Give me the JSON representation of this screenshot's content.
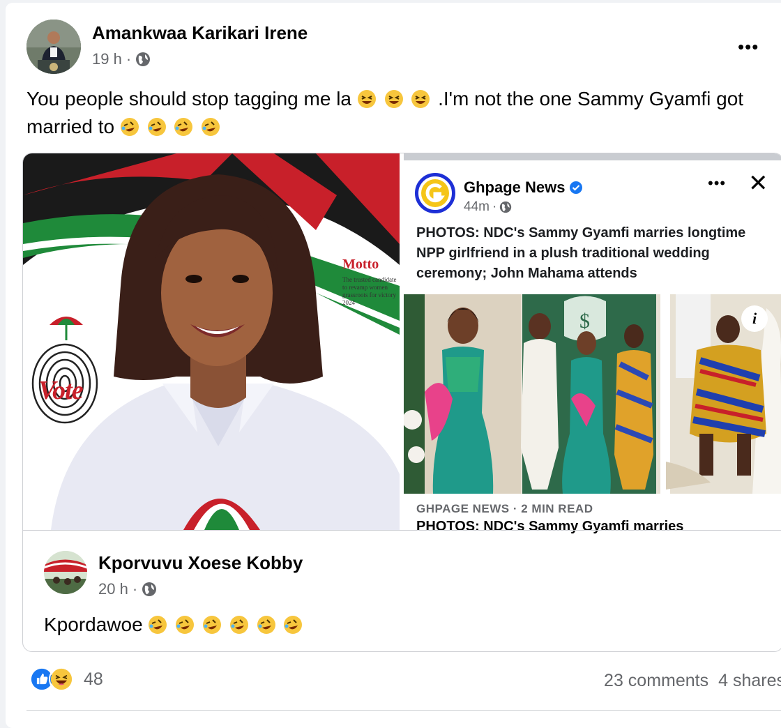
{
  "post": {
    "author": "Amankwaa Karikari Irene",
    "time": "19 h",
    "separator": "·",
    "text_part1": "You people should stop tagging me la ",
    "text_part2": ".I'm not the one Sammy Gyamfi got married to ",
    "more_label": "•••"
  },
  "left_photo": {
    "motto_title": "Motto",
    "motto_text": "The trusted candidate to revamp women grassroots for victory 2024",
    "vote_word": "Vote"
  },
  "shared_post": {
    "page_name": "Ghpage News",
    "time": "44m",
    "separator": "·",
    "more_label": "•••",
    "close_label": "✕",
    "headline": "PHOTOS: NDC's Sammy Gyamfi marries longtime NPP girlfriend in a plush traditional wedding ceremony; John Mahama attends",
    "info_label": "i",
    "source_label": "GHPAGE NEWS · 2 MIN READ",
    "source_title": "PHOTOS: NDC's Sammy Gyamfi marries"
  },
  "comment": {
    "author": "Kporvuvu Xoese Kobby",
    "time": "20 h",
    "separator": "·",
    "text": "Kpordawoe "
  },
  "footer": {
    "reaction_count": "48",
    "comments": "23 comments",
    "shares": "4 shares"
  },
  "colors": {
    "ndc_red": "#c8202a",
    "ndc_green": "#1f8a3a",
    "facebook_blue": "#1877f2",
    "secondary_text": "#65676b"
  },
  "icons": [
    "globe-icon",
    "more-icon",
    "close-icon",
    "verified-icon",
    "info-icon",
    "like-icon",
    "haha-icon",
    "grin-emoji",
    "rofl-emoji"
  ]
}
